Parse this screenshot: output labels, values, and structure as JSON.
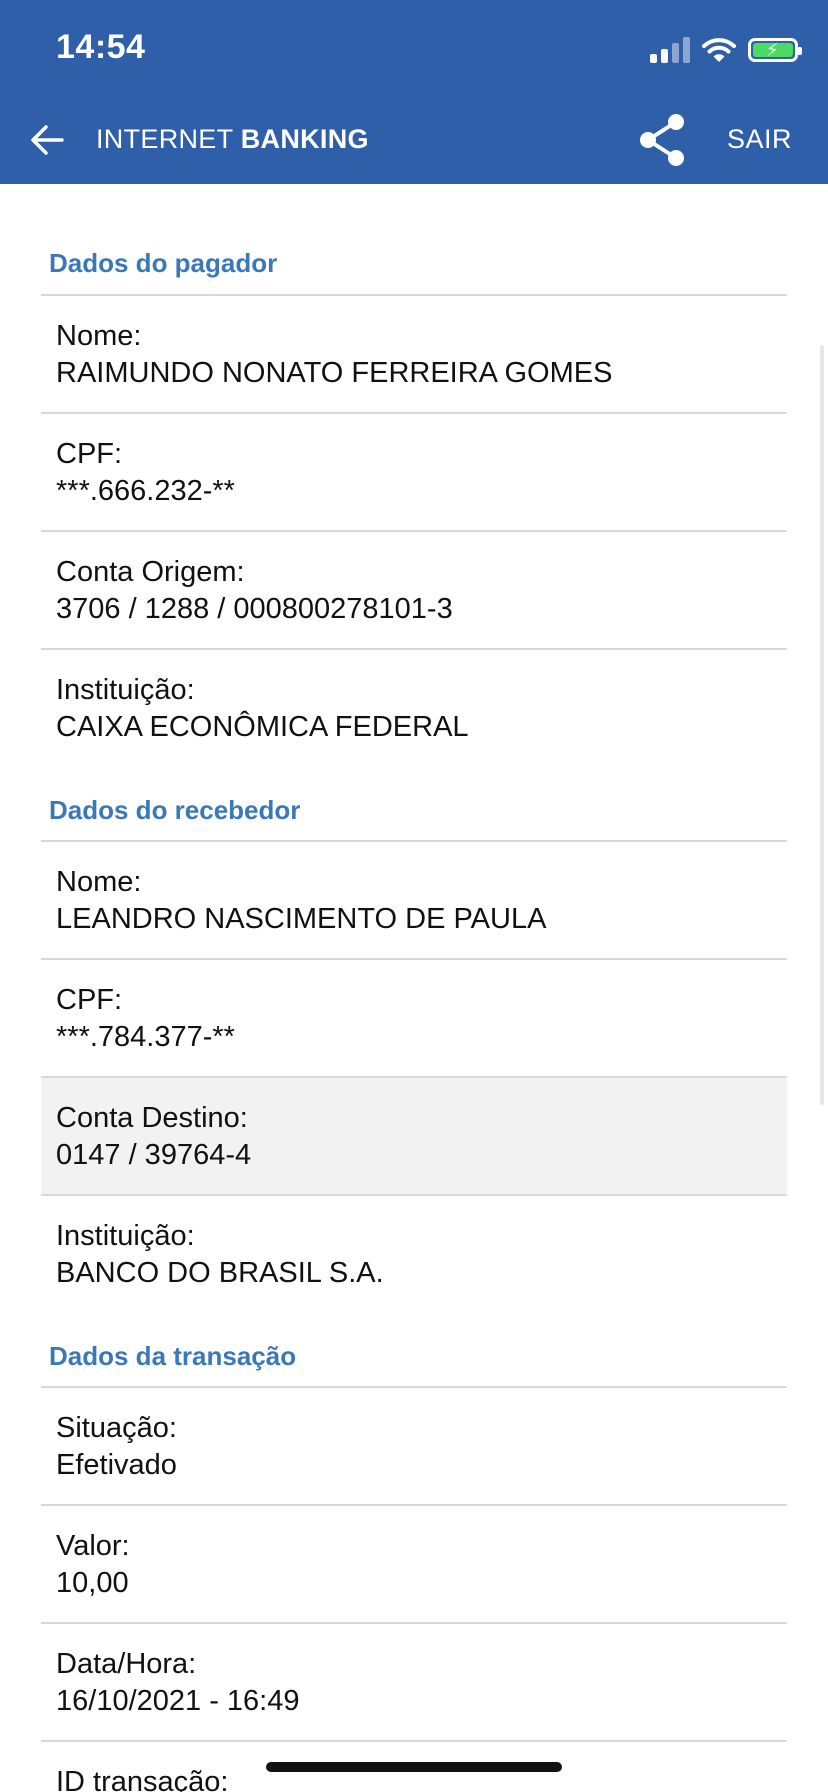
{
  "status_bar": {
    "time": "14:54"
  },
  "nav": {
    "title_light": "INTERNET",
    "title_bold": "BANKING",
    "sair_label": "SAIR"
  },
  "pagador": {
    "section_title": "Dados do pagador",
    "rows": [
      {
        "label": "Nome:",
        "value": "RAIMUNDO NONATO FERREIRA GOMES"
      },
      {
        "label": "CPF:",
        "value": "***.666.232-**"
      },
      {
        "label": "Conta Origem:",
        "value": "3706 / 1288 / 000800278101-3"
      },
      {
        "label": "Instituição:",
        "value": "CAIXA ECONÔMICA FEDERAL"
      }
    ]
  },
  "recebedor": {
    "section_title": "Dados do recebedor",
    "rows": [
      {
        "label": "Nome:",
        "value": "LEANDRO NASCIMENTO DE PAULA"
      },
      {
        "label": "CPF:",
        "value": "***.784.377-**"
      },
      {
        "label": "Conta Destino:",
        "value": "0147 / 39764-4"
      },
      {
        "label": "Instituição:",
        "value": "BANCO DO BRASIL S.A."
      }
    ]
  },
  "transacao": {
    "section_title": "Dados da transação",
    "rows": [
      {
        "label": "Situação:",
        "value": "Efetivado"
      },
      {
        "label": "Valor:",
        "value": "10,00"
      },
      {
        "label": "Data/Hora:",
        "value": "16/10/2021 - 16:49"
      },
      {
        "label": "ID transação:",
        "value": ""
      }
    ]
  },
  "colors": {
    "header_bg": "#2f5fa8",
    "section_title": "#3b78b8",
    "battery_fill": "#4cd964",
    "highlight_row": "#f3f2f3"
  }
}
